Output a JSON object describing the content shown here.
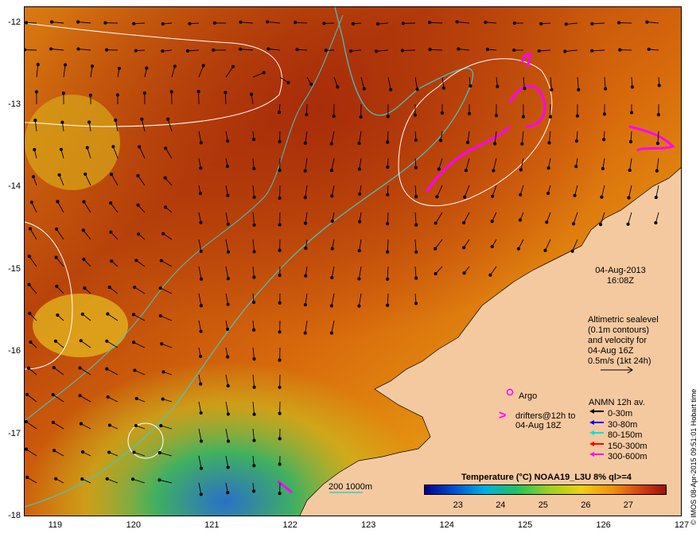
{
  "map": {
    "y_ticks": [
      "-12",
      "-13",
      "-14",
      "-15",
      "-16",
      "-17",
      "-18"
    ],
    "x_ticks": [
      "119",
      "120",
      "121",
      "122",
      "123",
      "124",
      "125",
      "126",
      "127"
    ],
    "lon_range": [
      118.6,
      127
    ],
    "lat_range": [
      -18,
      -11.8
    ]
  },
  "info": {
    "date": "04-Aug-2013",
    "time": "16:08Z",
    "altimetry_lines": [
      "Altimetric sealevel",
      "(0.1m contours)",
      "and velocity for",
      "04-Aug 16Z",
      "0.5m/s (1kt 24h)"
    ]
  },
  "legend": {
    "argo": "Argo",
    "drifters_line1": "drifters@12h to",
    "drifters_line2": "04-Aug 18Z",
    "anmn_title": "ANMN 12h av.",
    "depths": [
      {
        "label": "0-30m",
        "color": "#000000"
      },
      {
        "label": "30-80m",
        "color": "#0000ff"
      },
      {
        "label": "80-150m",
        "color": "#00e0e0"
      },
      {
        "label": "150-300m",
        "color": "#ff0000"
      },
      {
        "label": "300-600m",
        "color": "#ff00ff"
      }
    ]
  },
  "colorbar": {
    "title": "Temperature (°C) NOAA19_L3U 8% ql>=4",
    "ticks": [
      "23",
      "24",
      "25",
      "26",
      "27"
    ],
    "range": [
      22.2,
      27.9
    ]
  },
  "contour_key": "200  1000m",
  "credit": "© IMOS 08-Apr-2015 09:51:01 Hobart time",
  "colors": {
    "land": "#f5c9a0",
    "isobath": "#40c8c8",
    "drifter": "#ff00ff"
  }
}
